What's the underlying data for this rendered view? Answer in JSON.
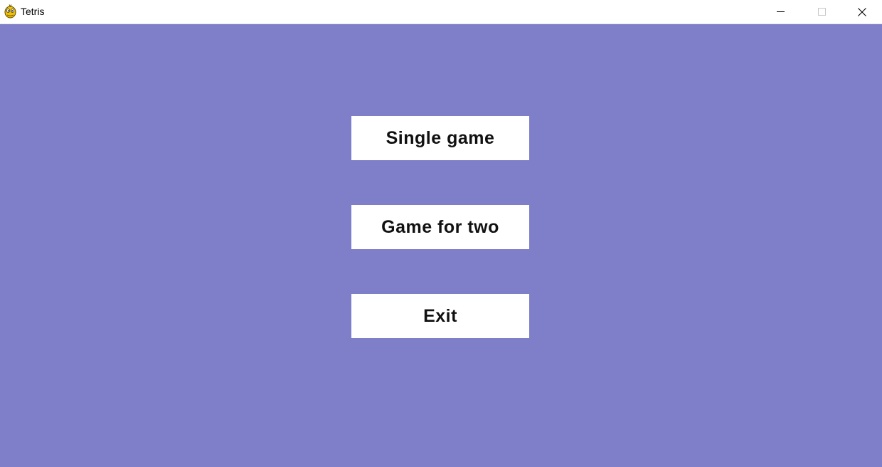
{
  "window": {
    "title": "Tetris",
    "icon": "pygame-snake-icon",
    "controls": {
      "minimize_icon": "minimize-icon",
      "maximize_icon": "maximize-icon",
      "close_icon": "close-icon"
    }
  },
  "colors": {
    "background": "#7f7fc9",
    "button_background": "#ffffff",
    "button_text": "#111111"
  },
  "menu": {
    "single_game_label": "Single game",
    "game_for_two_label": "Game for two",
    "exit_label": "Exit"
  }
}
